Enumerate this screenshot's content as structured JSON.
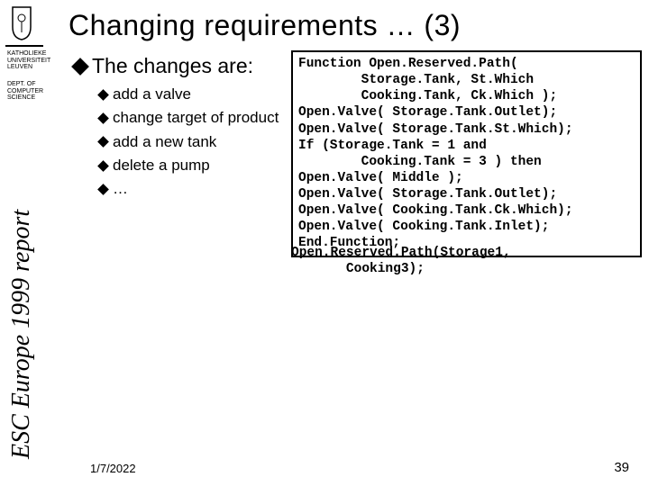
{
  "title": "Changing requirements … (3)",
  "org": {
    "university": "KATHOLIEKE\nUNIVERSITEIT\nLEUVEN",
    "department": "DEPT. OF\nCOMPUTER\nSCIENCE"
  },
  "sidebar_text": "ESC Europe 1999 report",
  "heading": "The changes are:",
  "bullets": {
    "b0": "add a valve",
    "b1": "change target of product",
    "b2": "add a new tank",
    "b3": "delete a pump",
    "b4": "…"
  },
  "code_lines": {
    "l0": "Function Open.Reserved.Path(",
    "l1": "        Storage.Tank, St.Which",
    "l2": "        Cooking.Tank, Ck.Which );",
    "l3": "Open.Valve( Storage.Tank.Outlet);",
    "l4": "Open.Valve( Storage.Tank.St.Which);",
    "l5": "If (Storage.Tank = 1 and",
    "l6": "        Cooking.Tank = 3 ) then",
    "l7": "Open.Valve( Middle );",
    "l8": "Open.Valve( Storage.Tank.Outlet);",
    "l9": "Open.Valve( Cooking.Tank.Ck.Which);",
    "l10": "Open.Valve( Cooking.Tank.Inlet);",
    "l11": "End.Function;"
  },
  "call_lines": {
    "c0": "Open.Reserved.Path(Storage1,",
    "c1": "       Cooking3);"
  },
  "footer": {
    "date": "1/7/2022",
    "page": "39"
  }
}
